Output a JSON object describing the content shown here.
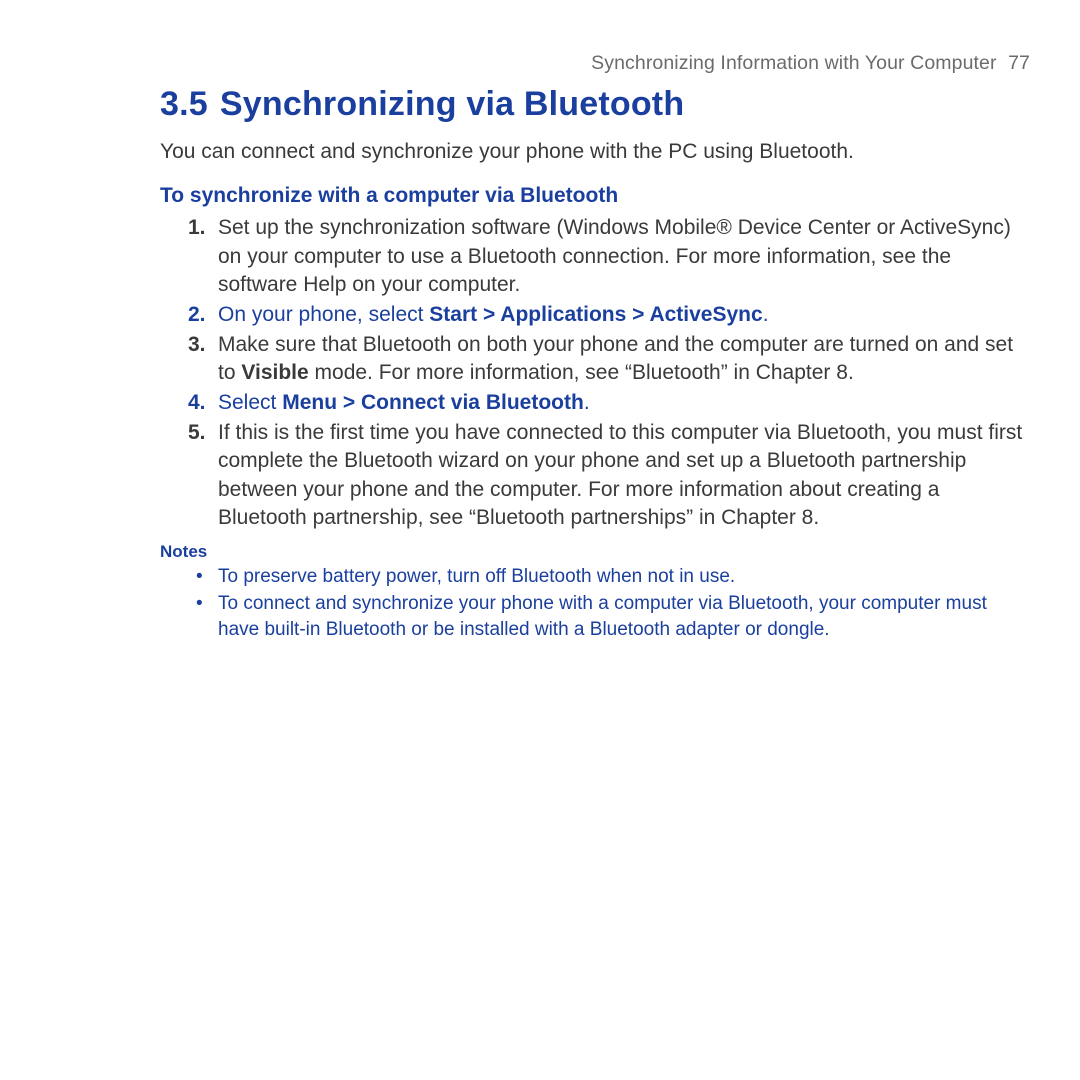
{
  "header": {
    "running_title": "Synchronizing Information with Your Computer",
    "page_number": "77"
  },
  "section": {
    "number": "3.5",
    "title": "Synchronizing via Bluetooth",
    "intro": "You can connect and synchronize your phone with the PC using Bluetooth."
  },
  "procedure": {
    "heading": "To synchronize with a computer via Bluetooth",
    "steps": {
      "s1": {
        "marker": "1.",
        "text": "Set up the synchronization software (Windows Mobile® Device Center or ActiveSync) on your computer to use a Bluetooth connection. For more information, see the software Help on your computer."
      },
      "s2": {
        "marker": "2.",
        "pre": "On your phone, select ",
        "bold": "Start > Applications > ActiveSync",
        "post": "."
      },
      "s3": {
        "marker": "3.",
        "pre": "Make sure that Bluetooth on both your phone and the computer are turned on and set to ",
        "bold": "Visible",
        "post": " mode. For more information, see “Bluetooth” in Chapter 8."
      },
      "s4": {
        "marker": "4.",
        "pre": "Select ",
        "bold": "Menu > Connect via Bluetooth",
        "post": "."
      },
      "s5": {
        "marker": "5.",
        "text": "If this is the first time you have connected to this computer via Bluetooth, you must first complete the Bluetooth wizard on your phone and set up a Bluetooth partnership between your phone and the computer. For more information about creating a Bluetooth partnership, see “Bluetooth partnerships” in Chapter 8."
      }
    }
  },
  "notes": {
    "label": "Notes",
    "items": {
      "n1": "To preserve battery power, turn off Bluetooth when not in use.",
      "n2": "To connect and synchronize your phone with a computer via Bluetooth, your computer must have built-in Bluetooth or be installed with a Bluetooth adapter or dongle."
    }
  }
}
